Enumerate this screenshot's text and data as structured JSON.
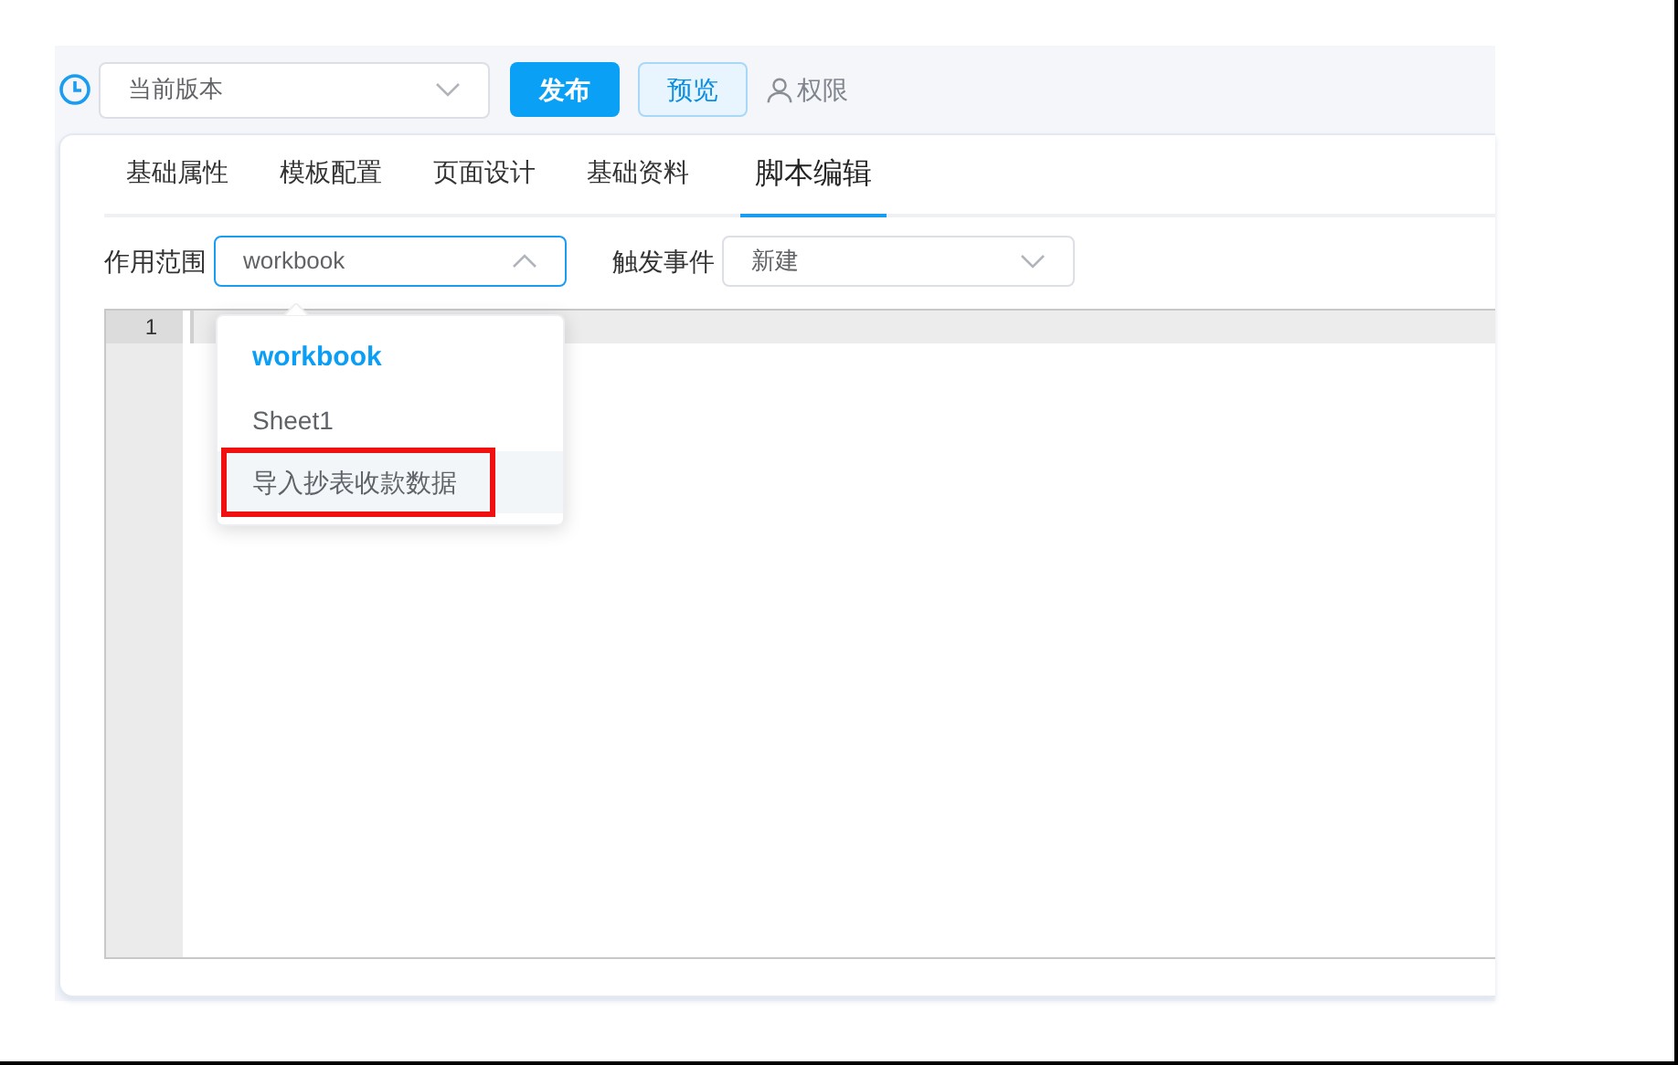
{
  "toolbar": {
    "version_select": {
      "value": "当前版本"
    },
    "buttons": [
      {
        "kind": "primary",
        "label": "发布"
      },
      {
        "kind": "secondary",
        "label": "预览"
      },
      {
        "kind": "link",
        "label": "权限"
      }
    ]
  },
  "tabs": [
    {
      "label": "基础属性",
      "selected": false
    },
    {
      "label": "模板配置",
      "selected": false
    },
    {
      "label": "页面设计",
      "selected": false
    },
    {
      "label": "基础资料",
      "selected": false
    },
    {
      "label": "脚本编辑",
      "selected": true
    }
  ],
  "filters": [
    {
      "label": "作用范围",
      "value": "workbook",
      "open": true
    },
    {
      "label": "触发事件",
      "value": "新建",
      "open": false
    }
  ],
  "scope_dropdown": {
    "options": [
      {
        "label": "workbook",
        "selected": true,
        "hovered": false,
        "highlighted": false
      },
      {
        "label": "Sheet1",
        "selected": false,
        "hovered": false,
        "highlighted": false
      },
      {
        "label": "导入抄表收款数据",
        "selected": false,
        "hovered": true,
        "highlighted": true
      }
    ]
  },
  "editor": {
    "line_numbers": [
      "1"
    ]
  }
}
